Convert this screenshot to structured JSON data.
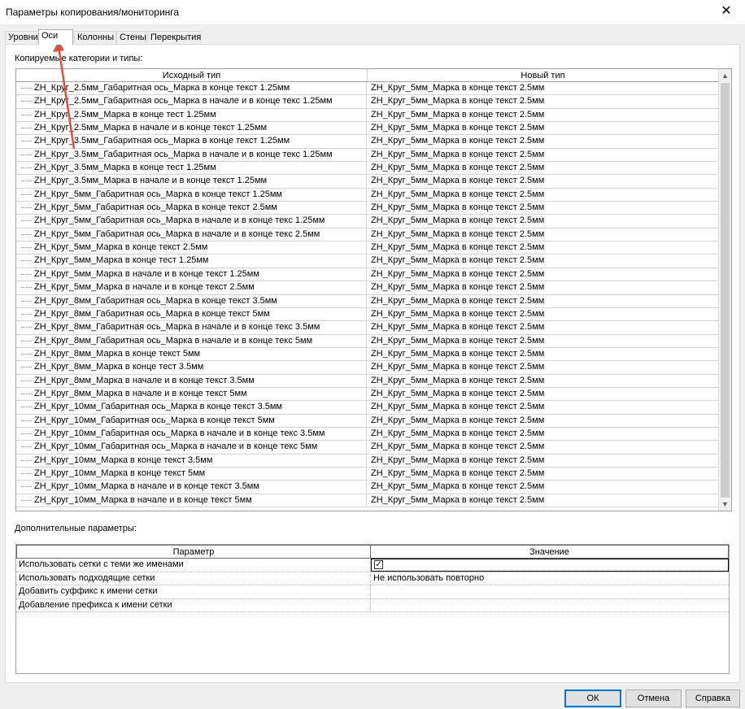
{
  "window": {
    "title": "Параметры копирования/мониторинга",
    "close_glyph": "✕"
  },
  "tabs": [
    {
      "label": "Уровни"
    },
    {
      "label": "Оси",
      "active": true
    },
    {
      "label": "Колонны"
    },
    {
      "label": "Стены"
    },
    {
      "label": "Перекрытия"
    }
  ],
  "types_section": {
    "label": "Копируемые категории и типы:",
    "columns": [
      "Исходный тип",
      "Новый тип"
    ],
    "rows": [
      [
        "ZH_Круг_2.5мм_Габаритная ось_Марка в конце текст 1.25мм",
        "ZH_Круг_5мм_Марка в конце текст 2.5мм"
      ],
      [
        "ZH_Круг_2.5мм_Габаритная ось_Марка в начале и в конце текс 1.25мм",
        "ZH_Круг_5мм_Марка в конце текст 2.5мм"
      ],
      [
        "ZH_Круг_2.5мм_Марка в конце тест 1.25мм",
        "ZH_Круг_5мм_Марка в конце текст 2.5мм"
      ],
      [
        "ZH_Круг_2.5мм_Марка в начале и в конце текст 1.25мм",
        "ZH_Круг_5мм_Марка в конце текст 2.5мм"
      ],
      [
        "ZH_Круг_3.5мм_Габаритная ось_Марка в конце текст 1.25мм",
        "ZH_Круг_5мм_Марка в конце текст 2.5мм"
      ],
      [
        "ZH_Круг_3.5мм_Габаритная ось_Марка в начале и в конце текс 1.25мм",
        "ZH_Круг_5мм_Марка в конце текст 2.5мм"
      ],
      [
        "ZH_Круг_3.5мм_Марка в конце тест 1.25мм",
        "ZH_Круг_5мм_Марка в конце текст 2.5мм"
      ],
      [
        "ZH_Круг_3.5мм_Марка в начале и в конце текст 1.25мм",
        "ZH_Круг_5мм_Марка в конце текст 2.5мм"
      ],
      [
        "ZH_Круг_5мм_Габаритная ось_Марка в конце текст 1.25мм",
        "ZH_Круг_5мм_Марка в конце текст 2.5мм"
      ],
      [
        "ZH_Круг_5мм_Габаритная ось_Марка в конце текст 2.5мм",
        "ZH_Круг_5мм_Марка в конце текст 2.5мм"
      ],
      [
        "ZH_Круг_5мм_Габаритная ось_Марка в начале и в конце текс 1.25мм",
        "ZH_Круг_5мм_Марка в конце текст 2.5мм"
      ],
      [
        "ZH_Круг_5мм_Габаритная ось_Марка в начале и в конце текс 2.5мм",
        "ZH_Круг_5мм_Марка в конце текст 2.5мм"
      ],
      [
        "ZH_Круг_5мм_Марка в конце текст 2.5мм",
        "ZH_Круг_5мм_Марка в конце текст 2.5мм"
      ],
      [
        "ZH_Круг_5мм_Марка в конце тест 1.25мм",
        "ZH_Круг_5мм_Марка в конце текст 2.5мм"
      ],
      [
        "ZH_Круг_5мм_Марка в начале и в конце текст 1.25мм",
        "ZH_Круг_5мм_Марка в конце текст 2.5мм"
      ],
      [
        "ZH_Круг_5мм_Марка в начале и в конце текст 2.5мм",
        "ZH_Круг_5мм_Марка в конце текст 2.5мм"
      ],
      [
        "ZH_Круг_8мм_Габаритная ось_Марка в конце текст 3.5мм",
        "ZH_Круг_5мм_Марка в конце текст 2.5мм"
      ],
      [
        "ZH_Круг_8мм_Габаритная ось_Марка в конце текст 5мм",
        "ZH_Круг_5мм_Марка в конце текст 2.5мм"
      ],
      [
        "ZH_Круг_8мм_Габаритная ось_Марка в начале и в конце текс 3.5мм",
        "ZH_Круг_5мм_Марка в конце текст 2.5мм"
      ],
      [
        "ZH_Круг_8мм_Габаритная ось_Марка в начале и в конце текс 5мм",
        "ZH_Круг_5мм_Марка в конце текст 2.5мм"
      ],
      [
        "ZH_Круг_8мм_Марка в конце текст 5мм",
        "ZH_Круг_5мм_Марка в конце текст 2.5мм"
      ],
      [
        "ZH_Круг_8мм_Марка в конце тест 3.5мм",
        "ZH_Круг_5мм_Марка в конце текст 2.5мм"
      ],
      [
        "ZH_Круг_8мм_Марка в начале и в конце текст 3.5мм",
        "ZH_Круг_5мм_Марка в конце текст 2.5мм"
      ],
      [
        "ZH_Круг_8мм_Марка в начале и в конце текст 5мм",
        "ZH_Круг_5мм_Марка в конце текст 2.5мм"
      ],
      [
        "ZH_Круг_10мм_Габаритная ось_Марка в конце текст 3.5мм",
        "ZH_Круг_5мм_Марка в конце текст 2.5мм"
      ],
      [
        "ZH_Круг_10мм_Габаритная ось_Марка в конце текст 5мм",
        "ZH_Круг_5мм_Марка в конце текст 2.5мм"
      ],
      [
        "ZH_Круг_10мм_Габаритная ось_Марка в начале и в конце текс 3.5мм",
        "ZH_Круг_5мм_Марка в конце текст 2.5мм"
      ],
      [
        "ZH_Круг_10мм_Габаритная ось_Марка в начале и в конце текс 5мм",
        "ZH_Круг_5мм_Марка в конце текст 2.5мм"
      ],
      [
        "ZH_Круг_10мм_Марка в конце текст 3.5мм",
        "ZH_Круг_5мм_Марка в конце текст 2.5мм"
      ],
      [
        "ZH_Круг_10мм_Марка в конце текст 5мм",
        "ZH_Круг_5мм_Марка в конце текст 2.5мм"
      ],
      [
        "ZH_Круг_10мм_Марка в начале и в конце текст 3.5мм",
        "ZH_Круг_5мм_Марка в конце текст 2.5мм"
      ],
      [
        "ZH_Круг_10мм_Марка в начале и в конце текст 5мм",
        "ZH_Круг_5мм_Марка в конце текст 2.5мм"
      ]
    ]
  },
  "additional_section": {
    "label": "Дополнительные параметры:",
    "columns": [
      "Параметр",
      "Значение"
    ],
    "rows": [
      {
        "name": "Использовать сетки с теми же именами",
        "checked": true,
        "value": ""
      },
      {
        "name": "Использовать подходящие сетки",
        "value": "Не использовать повторно"
      },
      {
        "name": "Добавить суффикс к имени сетки",
        "value": ""
      },
      {
        "name": "Добавление префикса к имени сетки",
        "value": ""
      }
    ]
  },
  "buttons": {
    "ok": "ОК",
    "cancel": "Отмена",
    "help": "Справка"
  },
  "annotation": {
    "color": "#e0503c",
    "target": "Оси"
  }
}
